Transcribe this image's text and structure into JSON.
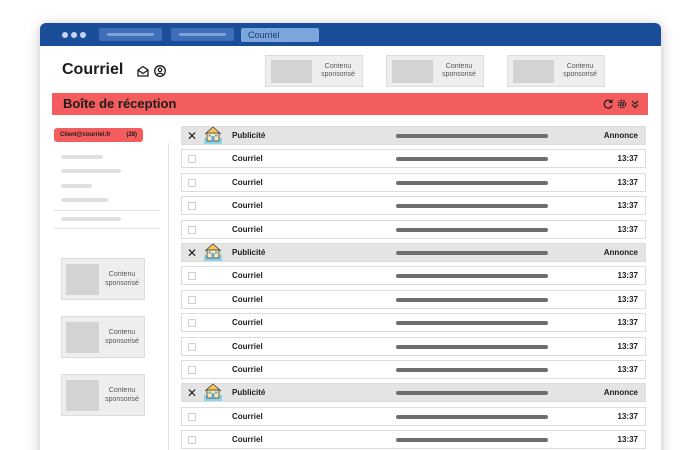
{
  "window": {
    "active_tab": "Courriel"
  },
  "header": {
    "title": "Courriel",
    "icons": [
      "envelope-open-icon",
      "account-icon"
    ],
    "sponsored": [
      "Contenu sponsorisé",
      "Contenu sponsorisé",
      "Contenu sponsorisé"
    ]
  },
  "inbox": {
    "title": "Boîte de réception",
    "actions": [
      "refresh-icon",
      "settings-icon",
      "collapse-icon"
    ]
  },
  "sidebar": {
    "account": "Client@courriel.fr",
    "unread": "(28)",
    "sponsored": [
      "Contenu sponsorisé",
      "Contenu sponsorisé",
      "Contenu sponsorisé"
    ]
  },
  "mails": [
    {
      "type": "ad",
      "sender": "Publicité",
      "time": "Annonce"
    },
    {
      "type": "mail",
      "sender": "Courriel",
      "time": "13:37"
    },
    {
      "type": "mail",
      "sender": "Courriel",
      "time": "13:37"
    },
    {
      "type": "mail",
      "sender": "Courriel",
      "time": "13:37"
    },
    {
      "type": "mail",
      "sender": "Courriel",
      "time": "13:37"
    },
    {
      "type": "ad",
      "sender": "Publicité",
      "time": "Annonce"
    },
    {
      "type": "mail",
      "sender": "Courriel",
      "time": "13:37"
    },
    {
      "type": "mail",
      "sender": "Courriel",
      "time": "13:37"
    },
    {
      "type": "mail",
      "sender": "Courriel",
      "time": "13:37"
    },
    {
      "type": "mail",
      "sender": "Courriel",
      "time": "13:37"
    },
    {
      "type": "mail",
      "sender": "Courriel",
      "time": "13:37"
    },
    {
      "type": "ad",
      "sender": "Publicité",
      "time": "Annonce"
    },
    {
      "type": "mail",
      "sender": "Courriel",
      "time": "13:37"
    },
    {
      "type": "mail",
      "sender": "Courriel",
      "time": "13:37"
    }
  ],
  "colors": {
    "titlebar": "#1a4e9a",
    "accent": "#f35d5d",
    "ad_row": "#e4e4e4"
  }
}
